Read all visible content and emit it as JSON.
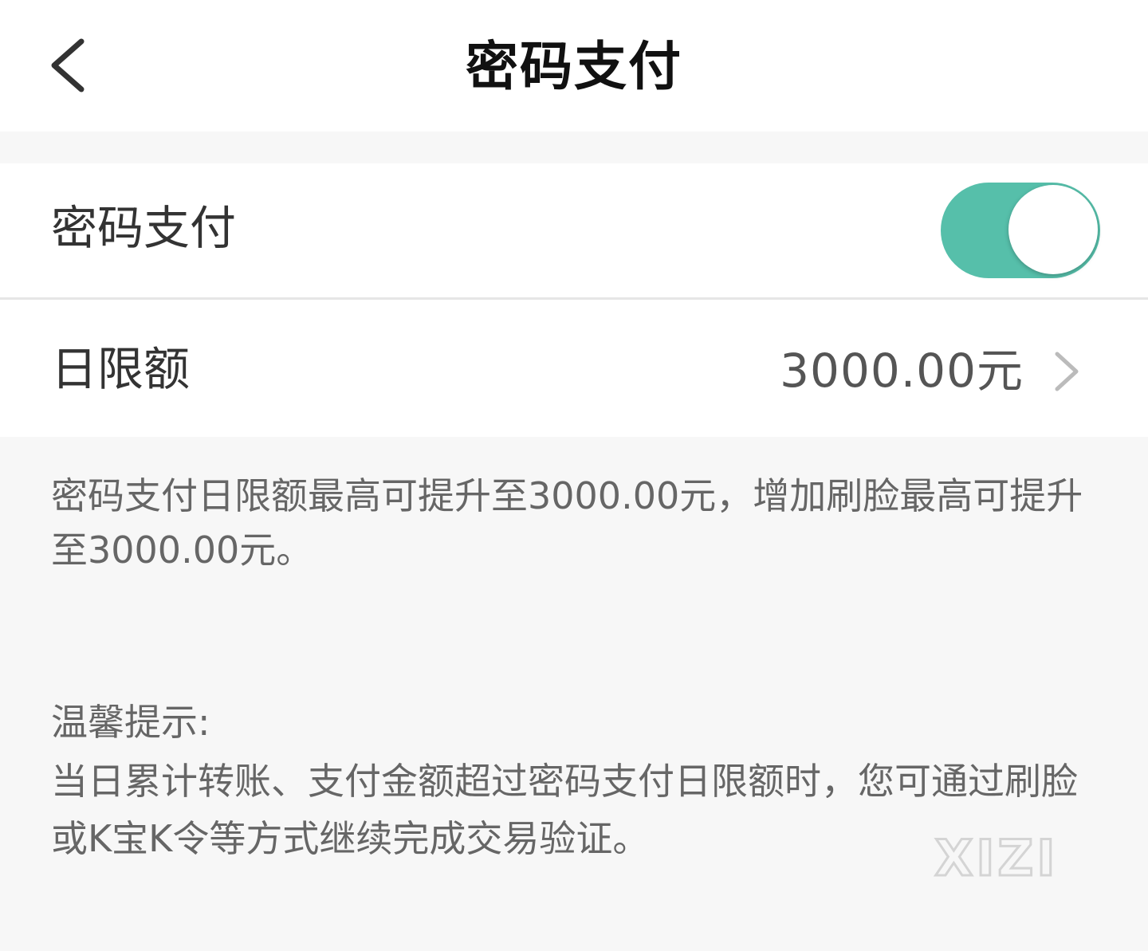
{
  "header": {
    "title": "密码支付"
  },
  "settings": {
    "password_pay": {
      "label": "密码支付",
      "toggle_on": true,
      "accent_color": "#56bfaa"
    },
    "daily_limit": {
      "label": "日限额",
      "value": "3000.00元"
    }
  },
  "description": "密码支付日限额最高可提升至3000.00元，增加刷脸最高可提升至3000.00元。",
  "tips": {
    "title": "温馨提示:",
    "text": "当日累计转账、支付金额超过密码支付日限额时，您可通过刷脸或K宝K令等方式继续完成交易验证。"
  },
  "watermark": {
    "text": "XIZI"
  },
  "icons": {
    "back": "chevron-left-icon",
    "row_arrow": "chevron-right-icon"
  }
}
